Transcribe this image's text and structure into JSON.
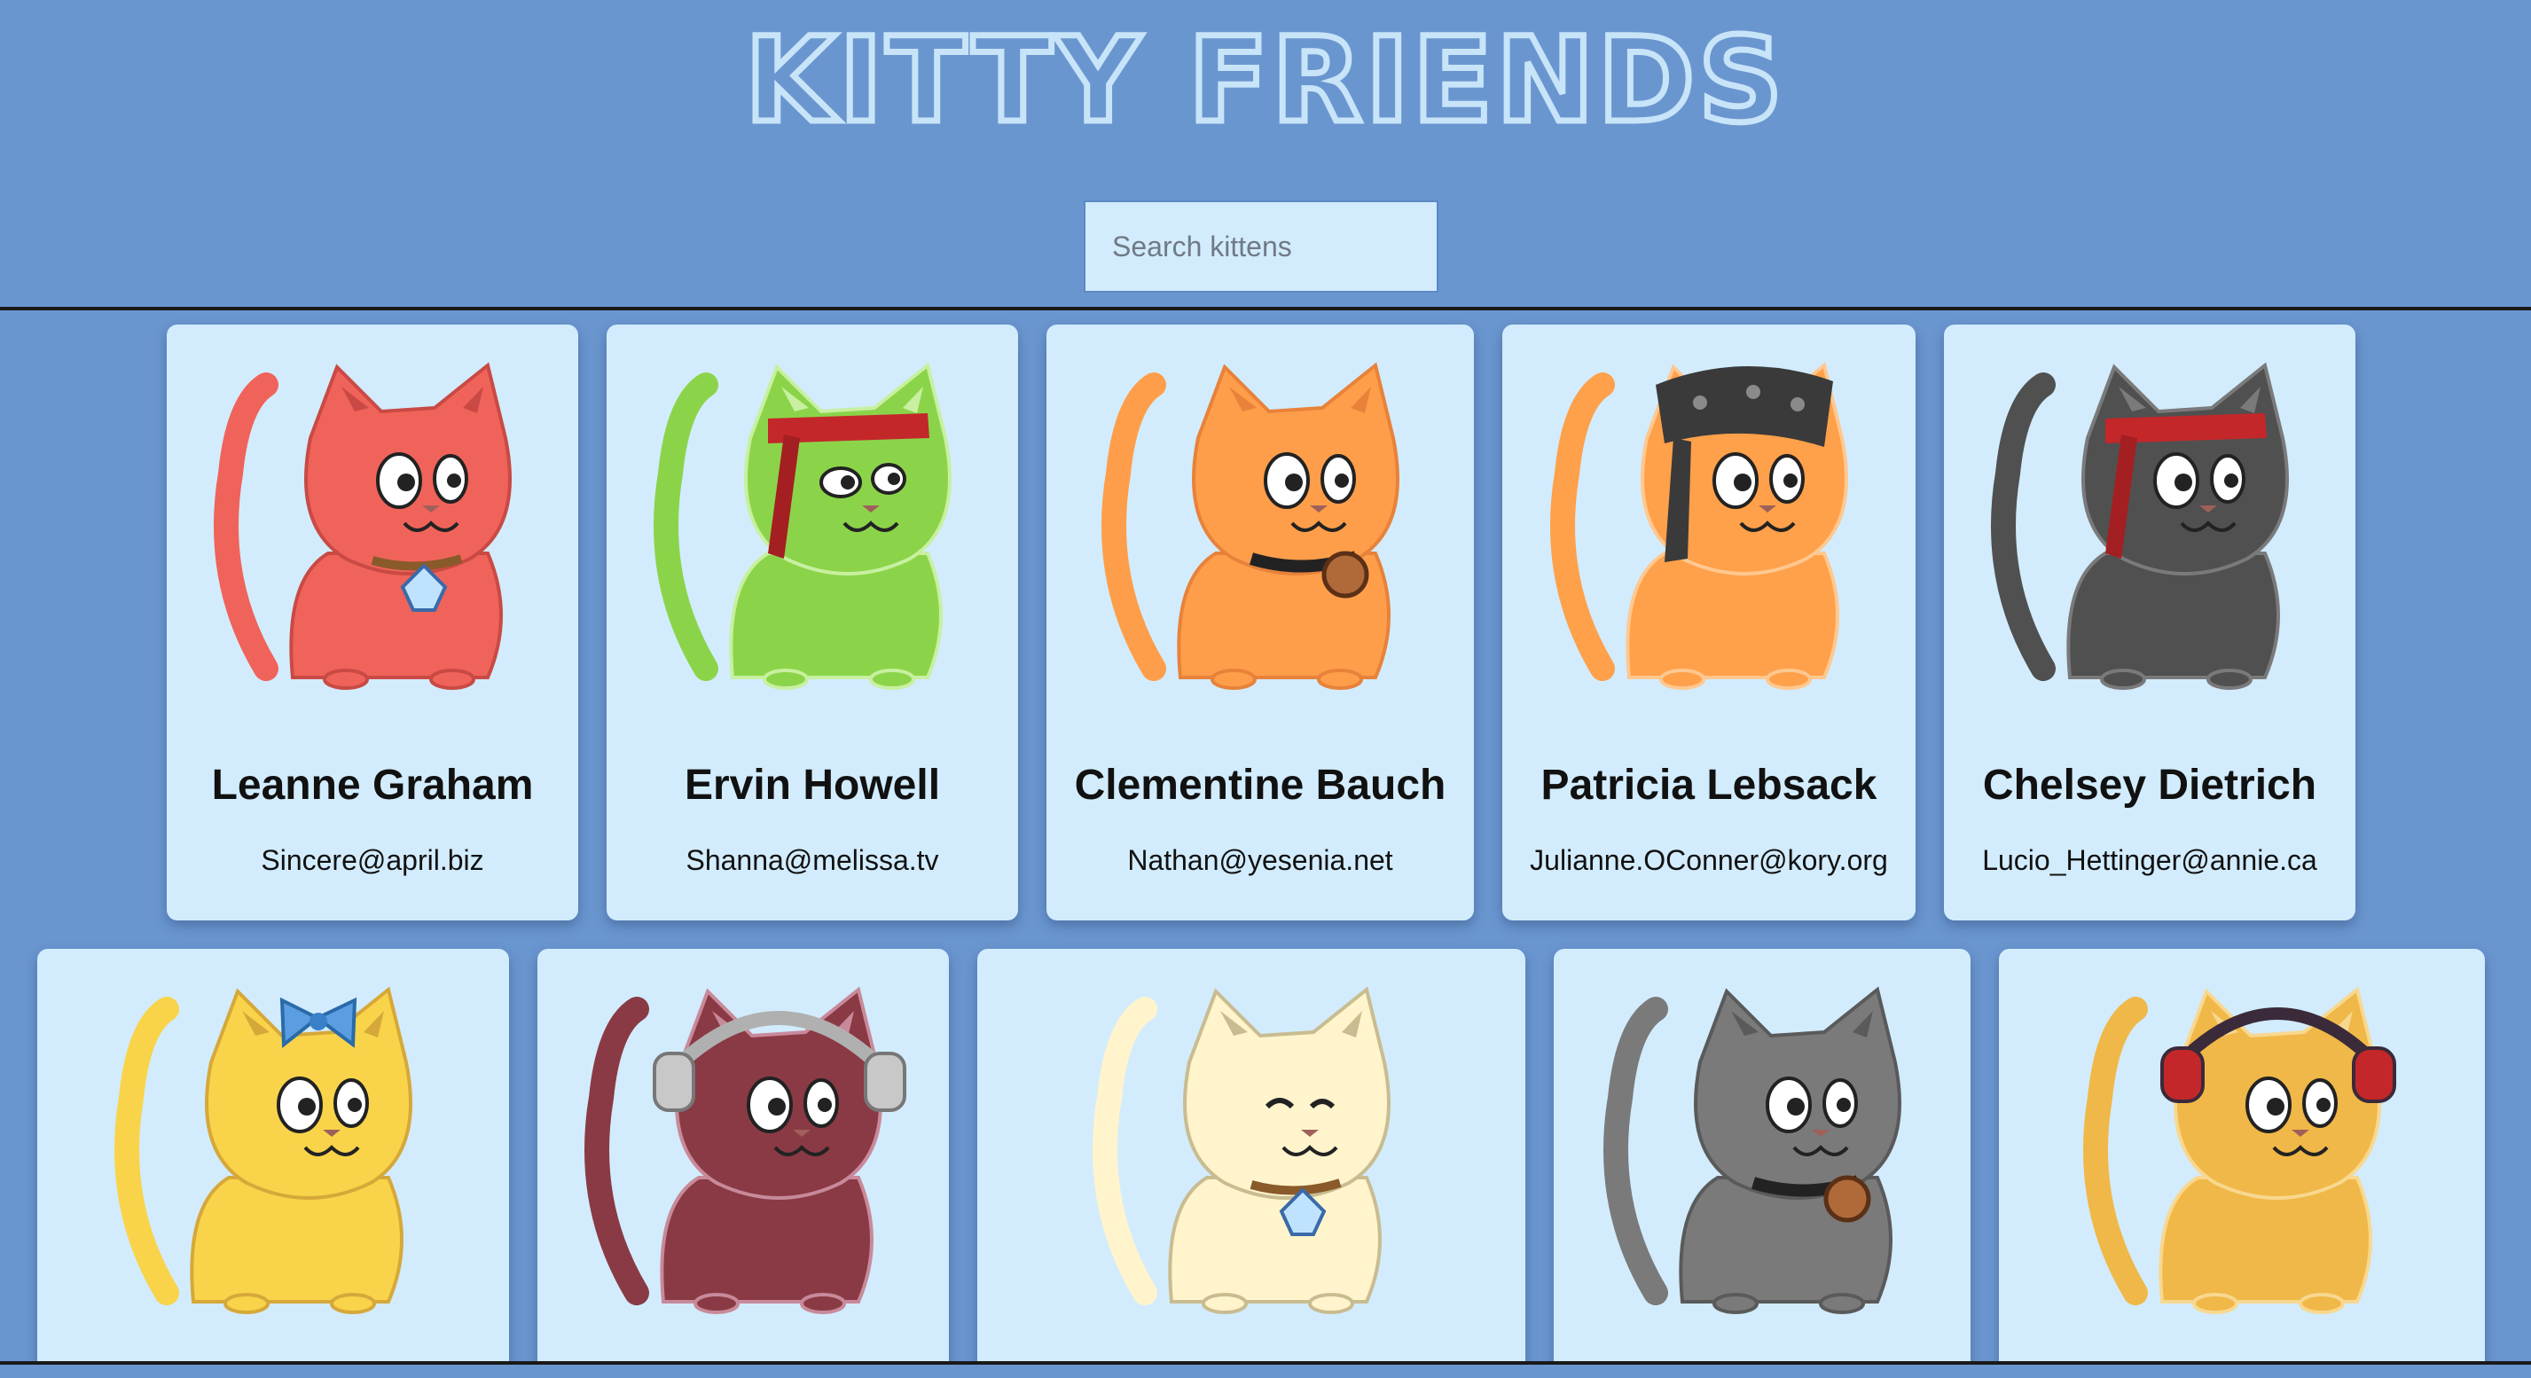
{
  "header": {
    "title": "KITTY FRIENDS",
    "search_placeholder": "Search kittens",
    "search_value": ""
  },
  "colors": {
    "background": "#6a96d0",
    "card": "#d2ecfd",
    "title_outline": "#c8e4f8"
  },
  "kittens": [
    {
      "name": "Leanne Graham",
      "email": "Sincere@april.biz",
      "body": "#f0635a",
      "accent": "#c94a44",
      "eye": "round",
      "accessory": "diamond-collar"
    },
    {
      "name": "Ervin Howell",
      "email": "Shanna@melissa.tv",
      "body": "#8bd44a",
      "accent": "#c8f0a0",
      "eye": "side",
      "accessory": "red-headband"
    },
    {
      "name": "Clementine Bauch",
      "email": "Nathan@yesenia.net",
      "body": "#ff9e4a",
      "accent": "#e8823a",
      "eye": "round",
      "accessory": "bell-collar"
    },
    {
      "name": "Patricia Lebsack",
      "email": "Julianne.OConner@kory.org",
      "body": "#ffa04a",
      "accent": "#ffc890",
      "eye": "round",
      "accessory": "bandana"
    },
    {
      "name": "Chelsey Dietrich",
      "email": "Lucio_Hettinger@annie.ca",
      "body": "#505050",
      "accent": "#7a7a7a",
      "eye": "round",
      "accessory": "red-headband"
    },
    {
      "name": "",
      "email": "",
      "body": "#f9d44a",
      "accent": "#d6a83a",
      "eye": "round",
      "accessory": "blue-bow"
    },
    {
      "name": "",
      "email": "",
      "body": "#8a3a44",
      "accent": "#c88a9a",
      "eye": "round",
      "accessory": "headphones"
    },
    {
      "name": "",
      "email": "",
      "body": "#fff4cc",
      "accent": "#c8bc90",
      "eye": "closed",
      "accessory": "diamond-collar"
    },
    {
      "name": "",
      "email": "",
      "body": "#7a7a7a",
      "accent": "#5a5a5a",
      "eye": "round",
      "accessory": "bell-collar"
    },
    {
      "name": "",
      "email": "",
      "body": "#f0b848",
      "accent": "#f8d890",
      "eye": "round",
      "accessory": "red-headphones"
    }
  ]
}
